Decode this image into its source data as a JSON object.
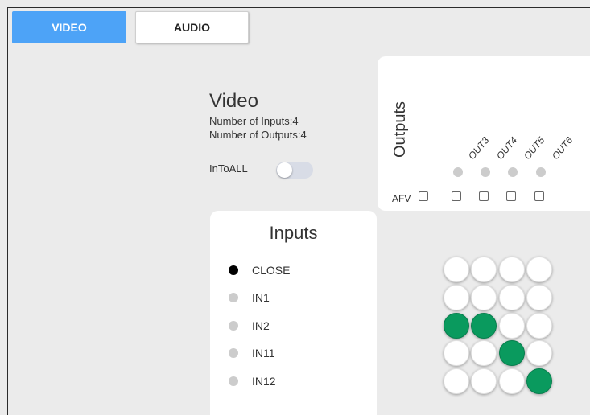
{
  "tabs": [
    {
      "label": "VIDEO",
      "active": true
    },
    {
      "label": "AUDIO",
      "active": false
    }
  ],
  "video": {
    "title": "Video",
    "num_inputs": "Number of Inputs:4",
    "num_outputs": "Number of Outputs:4",
    "intoall_label": "InToALL",
    "intoall_on": false
  },
  "outputs": {
    "label": "Outputs",
    "afv_label": "AFV",
    "items": [
      "OUT3",
      "OUT4",
      "OUT5",
      "OUT6"
    ]
  },
  "inputs": {
    "label": "Inputs",
    "items": [
      {
        "name": "CLOSE",
        "selected": true
      },
      {
        "name": "IN1",
        "selected": false
      },
      {
        "name": "IN2",
        "selected": false
      },
      {
        "name": "IN11",
        "selected": false
      },
      {
        "name": "IN12",
        "selected": false
      }
    ]
  },
  "matrix": [
    [
      false,
      false,
      false,
      false
    ],
    [
      false,
      false,
      false,
      false
    ],
    [
      true,
      true,
      false,
      false
    ],
    [
      false,
      false,
      true,
      false
    ],
    [
      false,
      false,
      false,
      true
    ]
  ],
  "colors": {
    "accent": "#4da3f7",
    "route_on": "#0a9a5e",
    "dot_inactive": "#cccccc"
  }
}
